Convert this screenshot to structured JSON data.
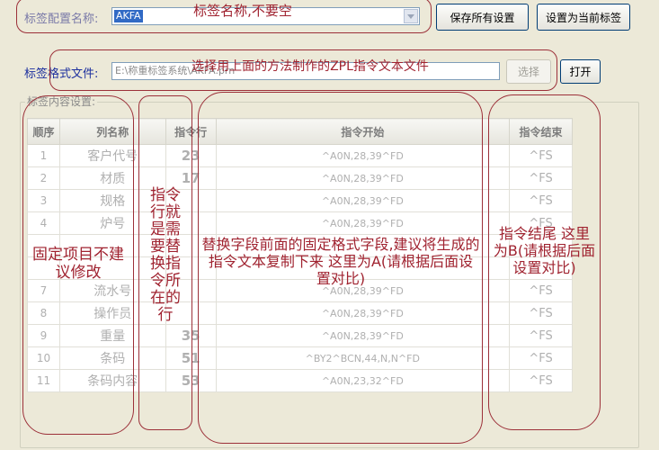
{
  "header": {
    "config_name_label": "标签配置名称:",
    "config_name_value": "AKFA",
    "save_all_label": "保存所有设置",
    "set_current_label": "设置为当前标签"
  },
  "format_file": {
    "label": "标签格式文件:",
    "path_value": "E:\\称重标签系统\\AKFA.prn",
    "choose_label": "选择",
    "open_label": "打开"
  },
  "content_group": {
    "title": "标签内容设置:"
  },
  "table": {
    "headers": [
      "顺序",
      "列名称",
      "指令行",
      "指令开始",
      "指令结束"
    ],
    "rows": [
      {
        "seq": "1",
        "name": "客户代号",
        "line": "23",
        "start": "^A0N,28,39^FD",
        "end": "^FS"
      },
      {
        "seq": "2",
        "name": "材质",
        "line": "17",
        "start": "^A0N,28,39^FD",
        "end": "^FS"
      },
      {
        "seq": "3",
        "name": "规格",
        "line": "",
        "start": "^A0N,28,39^FD",
        "end": "^FS"
      },
      {
        "seq": "4",
        "name": "炉号",
        "line": "",
        "start": "^A0N,28,39^FD",
        "end": "^FS"
      },
      {
        "seq": "",
        "name": "",
        "line": "",
        "start": "",
        "end": ""
      },
      {
        "seq": "",
        "name": "",
        "line": "",
        "start": "",
        "end": ""
      },
      {
        "seq": "7",
        "name": "流水号",
        "line": "",
        "start": "^A0N,28,39^FD",
        "end": "^FS"
      },
      {
        "seq": "8",
        "name": "操作员",
        "line": "",
        "start": "^A0N,28,39^FD",
        "end": "^FS"
      },
      {
        "seq": "9",
        "name": "重量",
        "line": "35",
        "start": "^A0N,28,39^FD",
        "end": "^FS"
      },
      {
        "seq": "10",
        "name": "条码",
        "line": "51",
        "start": "^BY2^BCN,44,N,N^FD",
        "end": "^FS"
      },
      {
        "seq": "11",
        "name": "条码内容",
        "line": "53",
        "start": "^A0N,23,32^FD",
        "end": "^FS"
      }
    ]
  },
  "annotations": {
    "name_note": "标签名称,不要空",
    "file_note": "选择用上面的方法制作的ZPL指令文本文件",
    "fixed_note": "固定项目不建议修改",
    "line_note": "指令行就是需要替换指令所在的行",
    "start_note": "替换字段前面的固定格式字段,建议将生成的指令文本复制下来 这里为A(请根据后面设置对比)",
    "end_note": "指令结尾 这里为B(请根据后面设置对比)"
  }
}
